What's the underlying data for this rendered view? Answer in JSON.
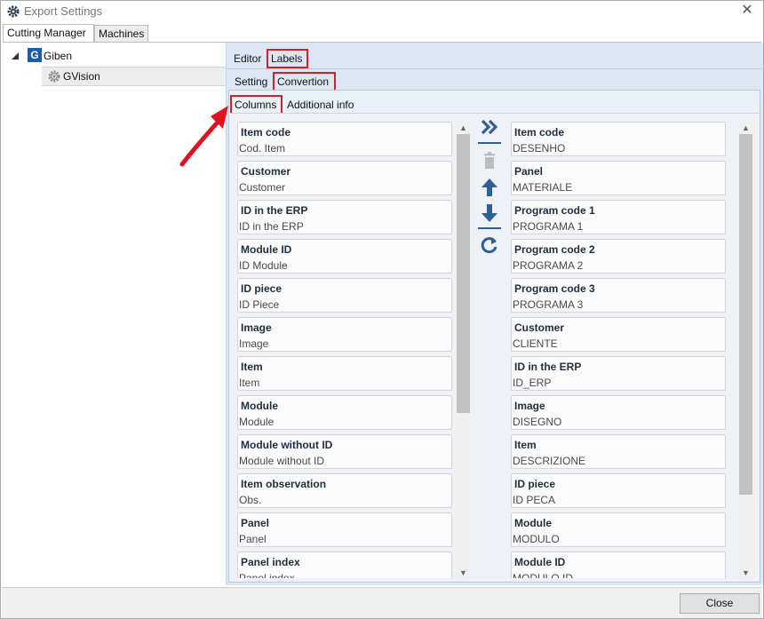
{
  "window": {
    "title": "Export Settings",
    "close_glyph": "✕"
  },
  "top_tabs": [
    {
      "label": "Cutting Manager"
    },
    {
      "label": "Machines"
    }
  ],
  "tree": {
    "root_label": "Giben",
    "root_logo": "G",
    "child_label": "GVision"
  },
  "tabs_level1": [
    {
      "label": "Editor"
    },
    {
      "label": "Labels"
    }
  ],
  "tabs_level2": [
    {
      "label": "Setting"
    },
    {
      "label": "Convertion"
    }
  ],
  "tabs_level3": [
    {
      "label": "Columns"
    },
    {
      "label": "Additional info"
    }
  ],
  "left_list": [
    {
      "title": "Item code",
      "sub": "Cod. Item"
    },
    {
      "title": "Customer",
      "sub": "Customer"
    },
    {
      "title": "ID in the ERP",
      "sub": "ID in the ERP"
    },
    {
      "title": "Module ID",
      "sub": "ID Module"
    },
    {
      "title": "ID piece",
      "sub": "ID Piece"
    },
    {
      "title": "Image",
      "sub": "Image"
    },
    {
      "title": "Item",
      "sub": "Item"
    },
    {
      "title": "Module",
      "sub": "Module"
    },
    {
      "title": "Module without ID",
      "sub": "Module without ID"
    },
    {
      "title": "Item observation",
      "sub": "Obs."
    },
    {
      "title": "Panel",
      "sub": "Panel"
    },
    {
      "title": "Panel index",
      "sub": "Panel index"
    }
  ],
  "right_list": [
    {
      "title": "Item code",
      "sub": "DESENHO"
    },
    {
      "title": "Panel",
      "sub": "MATERIALE"
    },
    {
      "title": "Program code 1",
      "sub": "PROGRAMA 1"
    },
    {
      "title": "Program code 2",
      "sub": "PROGRAMA 2"
    },
    {
      "title": "Program code 3",
      "sub": "PROGRAMA 3"
    },
    {
      "title": "Customer",
      "sub": "CLIENTE"
    },
    {
      "title": "ID in the ERP",
      "sub": "ID_ERP"
    },
    {
      "title": "Image",
      "sub": "DISEGNO"
    },
    {
      "title": "Item",
      "sub": "DESCRIZIONE"
    },
    {
      "title": "ID piece",
      "sub": "ID PECA"
    },
    {
      "title": "Module",
      "sub": "MODULO"
    },
    {
      "title": "Module ID",
      "sub": "MODULO ID"
    }
  ],
  "scroll_arrows": {
    "up": "▲",
    "down": "▼"
  },
  "footer": {
    "close_label": "Close"
  },
  "colors": {
    "accent_blue": "#2f5f97",
    "highlight_red": "#d1222a",
    "panel_bg": "#dce7f3"
  }
}
